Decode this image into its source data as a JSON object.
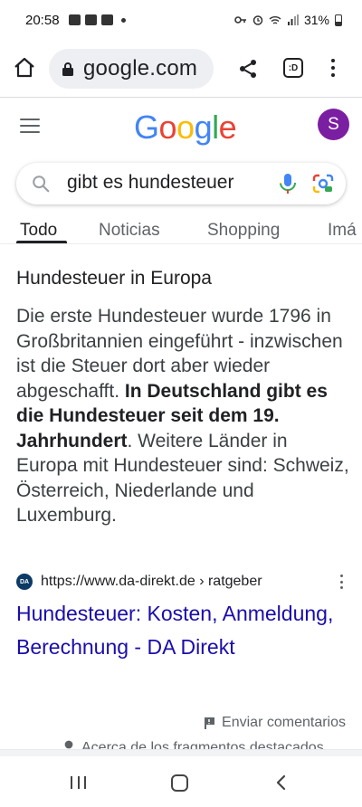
{
  "status_bar": {
    "time": "20:58",
    "battery": "31%"
  },
  "browser": {
    "url": "google.com",
    "tabs_count": ":D"
  },
  "header": {
    "logo": "Google",
    "logo_colors": [
      "#4285F4",
      "#EA4335",
      "#FBBC05",
      "#4285F4",
      "#34A853",
      "#EA4335"
    ],
    "avatar_letter": "S",
    "avatar_color": "#7B1FA2"
  },
  "search": {
    "query": "gibt es hundesteuer"
  },
  "tabs": [
    {
      "label": "Todo",
      "active": true
    },
    {
      "label": "Noticias",
      "active": false
    },
    {
      "label": "Shopping",
      "active": false
    },
    {
      "label": "Imá",
      "active": false
    }
  ],
  "result": {
    "heading": "Hundesteuer in Europa",
    "text_part1": "Die erste Hundesteuer wurde 1796 in Großbritannien eingeführt - inzwischen ist die Steuer dort aber wieder abgeschafft. ",
    "text_bold": "In Deutschland gibt es die Hundesteuer seit dem 19. Jahrhundert",
    "text_part2": ". Weitere Länder in Europa mit Hundesteuer sind: Schweiz, Österreich, Niederlande und Luxemburg.",
    "favicon_text": "DA",
    "source_url": "https://www.da-direkt.de › ratgeber",
    "link_title": "Hundesteuer: Kosten, Anmeldung, Berechnung - DA Direkt"
  },
  "feedback": {
    "label": "Enviar comentarios",
    "partial_text": "Acerca de los fragmentos destacados"
  },
  "colors": {
    "link": "#1A0DAB",
    "text": "#202124",
    "secondary": "#5F6368"
  }
}
